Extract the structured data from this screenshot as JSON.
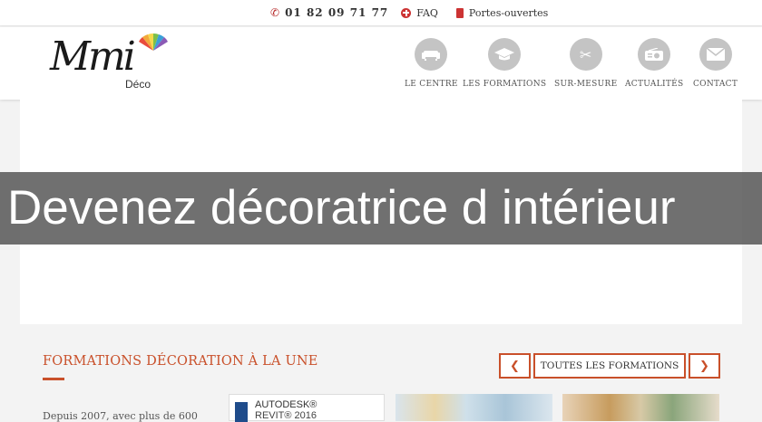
{
  "topbar": {
    "phone": "01 82 09 71 77",
    "faq": "FAQ",
    "portes": "Portes-ouvertes"
  },
  "logo": {
    "script": "Mmi",
    "sub": "Déco"
  },
  "nav": [
    {
      "label": "LE CENTRE",
      "icon": "sofa-icon"
    },
    {
      "label": "LES FORMATIONS",
      "icon": "graduation-cap-icon"
    },
    {
      "label": "SUR-MESURE",
      "icon": "scissors-icon"
    },
    {
      "label": "ACTUALITÉS",
      "icon": "radio-icon"
    },
    {
      "label": "CONTACT",
      "icon": "envelope-icon"
    }
  ],
  "banner": {
    "text": "Devenez décoratrice d intérieur"
  },
  "section": {
    "title": "FORMATIONS DÉCORATION À LA UNE",
    "all_button": "TOUTES LES FORMATIONS",
    "intro": "Depuis 2007, avec plus de 600",
    "thumb1_line1": "AUTODESK®",
    "thumb1_line2": "REVIT® 2016"
  },
  "colors": {
    "accent": "#c9502a",
    "banner_bg": "#505050",
    "nav_icon_bg": "#c4c4c4"
  }
}
